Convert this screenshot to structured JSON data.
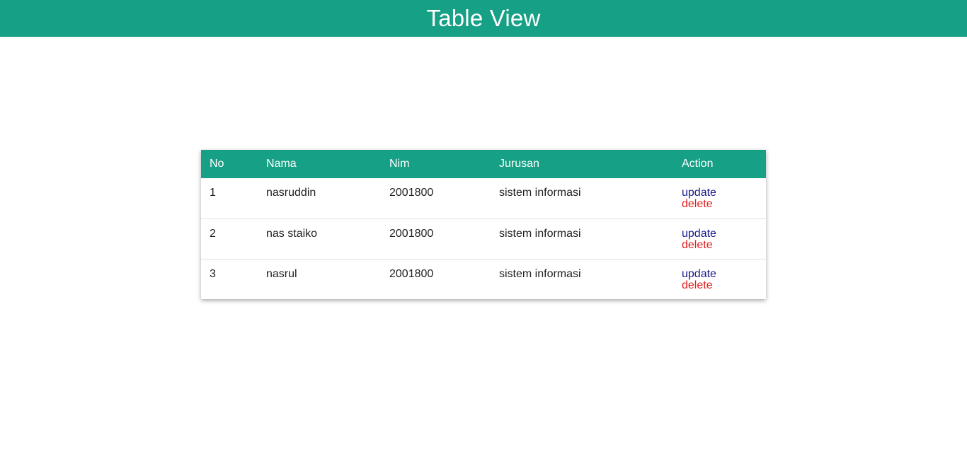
{
  "header": {
    "title": "Table View"
  },
  "table": {
    "columns": [
      "No",
      "Nama",
      "Nim",
      "Jurusan",
      "Action"
    ],
    "rows": [
      {
        "no": "1",
        "nama": "nasruddin",
        "nim": "2001800",
        "jurusan": "sistem informasi",
        "update": "update",
        "delete": "delete"
      },
      {
        "no": "2",
        "nama": "nas staiko",
        "nim": "2001800",
        "jurusan": "sistem informasi",
        "update": "update",
        "delete": "delete"
      },
      {
        "no": "3",
        "nama": "nasrul",
        "nim": "2001800",
        "jurusan": "sistem informasi",
        "update": "update",
        "delete": "delete"
      }
    ]
  },
  "colors": {
    "accent": "#16a085",
    "update_link": "#1a1a8c",
    "delete_link": "#e01b1b"
  }
}
